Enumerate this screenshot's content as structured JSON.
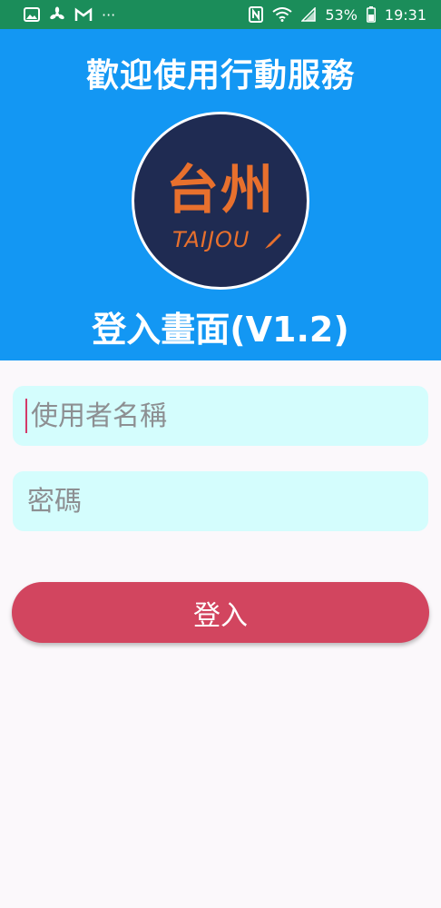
{
  "status_bar": {
    "battery": "53%",
    "time": "19:31",
    "overflow": "···"
  },
  "header": {
    "welcome": "歡迎使用行動服務",
    "logo_cn": "台州",
    "logo_en": "TAIJOU",
    "login_title": "登入畫面(V1.2)"
  },
  "form": {
    "username_placeholder": "使用者名稱",
    "password_placeholder": "密碼",
    "login_label": "登入"
  },
  "colors": {
    "status_bar": "#1b8d5a",
    "header": "#1397f3",
    "input_bg": "#d4fdfd",
    "login_button": "#d2455f",
    "logo_bg": "#1f2b52",
    "logo_text": "#e8702d"
  }
}
